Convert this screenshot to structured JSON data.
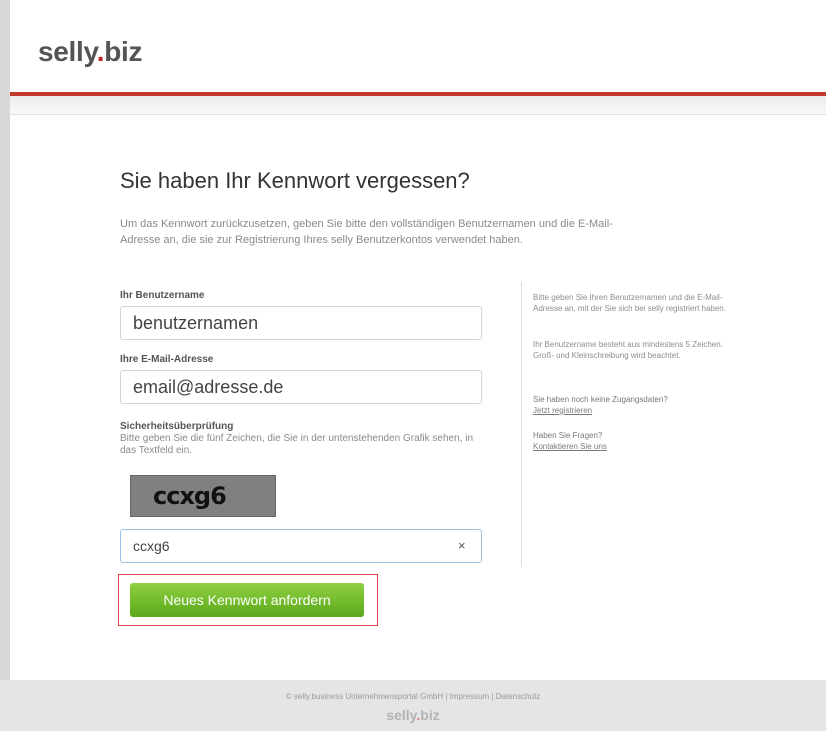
{
  "brand": {
    "name": "selly",
    "dot": ".",
    "tld": "biz",
    "accent_color": "#c0392b"
  },
  "title": "Sie haben Ihr Kennwort vergessen?",
  "intro": "Um das Kennwort zurückzusetzen, geben Sie bitte den vollständigen Benutzernamen und die E-Mail-Adresse an, die sie zur Registrierung Ihres selly Benutzerkontos verwendet haben.",
  "form": {
    "username_label": "Ihr Benutzername",
    "username_value": "benutzernamen",
    "email_label": "Ihre E-Mail-Adresse",
    "email_value": "email@adresse.de",
    "captcha_label": "Sicherheitsüberprüfung",
    "captcha_desc": "Bitte geben Sie die fünf Zeichen, die Sie in der untenstehenden Grafik sehen, in das Textfeld ein.",
    "captcha_text": "ccxg6",
    "captcha_value": "ccxg6",
    "clear_icon": "×",
    "submit_label": "Neues Kennwort anfordern",
    "submit_color": "#6cba2a"
  },
  "sidebar": {
    "hint1": "Bitte geben Sie Ihren Benutzernamen und die E-Mail-Adresse an, mit der Sie sich bei selly registriert haben.",
    "hint2": "Ihr Benutzername besteht aus mindestens 5 Zeichen. Groß- und Kleinschreibung wird beachtet.",
    "noaccess_q": "Sie haben noch keine Zugangsdaten?",
    "noaccess_link": "Jetzt registrieren",
    "questions_q": "Haben Sie Fragen?",
    "questions_link": "Kontaktieren Sie uns"
  },
  "footer": {
    "links": "© selly.business Unternehmensportal GmbH | Impressum | Datenschutz",
    "logo_name": "selly",
    "logo_dot": ".",
    "logo_tld": "biz"
  }
}
